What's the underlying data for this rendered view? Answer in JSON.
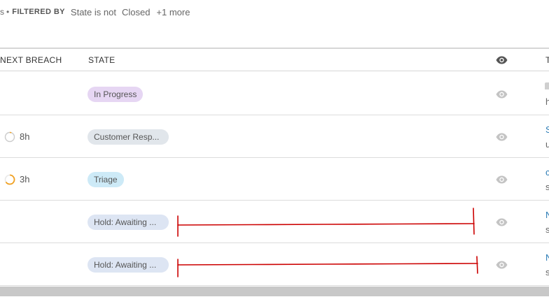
{
  "filter": {
    "prefix": "s",
    "separator": "•",
    "label": "FILTERED BY",
    "chips": [
      "State is not",
      "Closed"
    ],
    "more": "+1 more"
  },
  "columns": {
    "next_breach": "NEXT BREACH",
    "state": "STATE",
    "watch_icon": "eye-icon",
    "truncated": "T"
  },
  "rows": [
    {
      "breach_value": "",
      "breach_timer": "none",
      "state": "In Progress",
      "state_color": "#e6d6f3",
      "col_title": "",
      "col_sub": "h"
    },
    {
      "breach_value": "8h",
      "breach_timer": "pending",
      "state": "Customer Resp...",
      "state_color": "#e1e6eb",
      "col_title": "S",
      "col_sub": "u"
    },
    {
      "breach_value": "3h",
      "breach_timer": "warning",
      "state": "Triage",
      "state_color": "#cdeaf7",
      "col_title": "c",
      "col_sub": "s"
    },
    {
      "breach_value": "",
      "breach_timer": "none",
      "state": "Hold: Awaiting ...",
      "state_color": "#dde5f3",
      "col_title": "N",
      "col_sub": "s"
    },
    {
      "breach_value": "",
      "breach_timer": "none",
      "state": "Hold: Awaiting ...",
      "state_color": "#dde5f3",
      "col_title": "N",
      "col_sub": "s"
    }
  ],
  "colors": {
    "link": "#2b7bb5",
    "timer_warning": "#f0a020",
    "timer_pending": "#cccccc",
    "annotation": "#cc0000"
  }
}
